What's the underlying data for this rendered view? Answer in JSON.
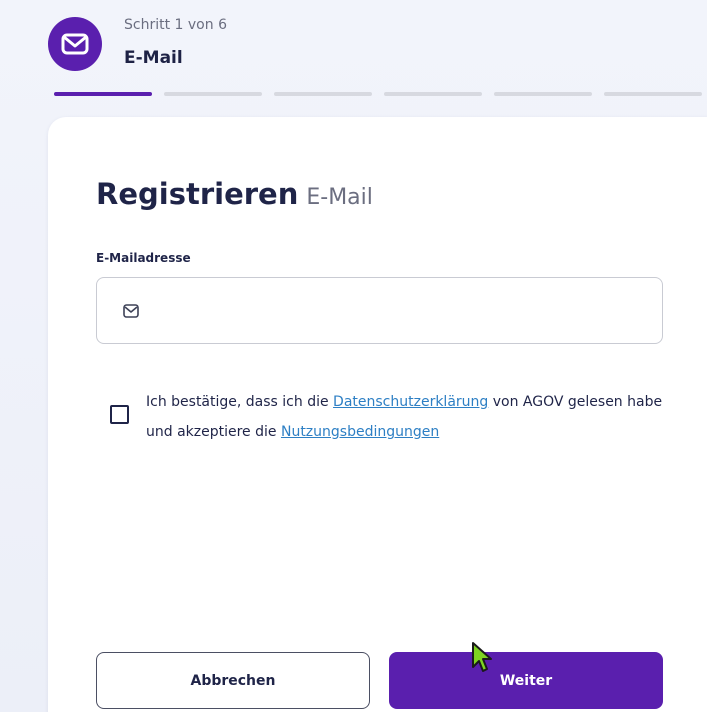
{
  "step": {
    "counter": "Schritt 1 von 6",
    "name": "E-Mail",
    "icon": "mail-icon",
    "total_steps": 6,
    "current_step": 1
  },
  "form": {
    "title": "Registrieren",
    "subtitle": "E-Mail",
    "email_label": "E-Mailadresse",
    "email_value": "",
    "email_icon": "mail-icon",
    "consent": {
      "text_1": "Ich bestätige, dass ich die ",
      "privacy_link": "Datenschutzerklärung",
      "text_2": " von AGOV gelesen habe und akzeptiere die ",
      "terms_link": "Nutzungsbedingungen",
      "checked": false
    }
  },
  "buttons": {
    "cancel": "Abbrechen",
    "next": "Weiter"
  },
  "colors": {
    "accent": "#5a1fae",
    "link": "#2d7fc4",
    "text": "#1f2448"
  }
}
